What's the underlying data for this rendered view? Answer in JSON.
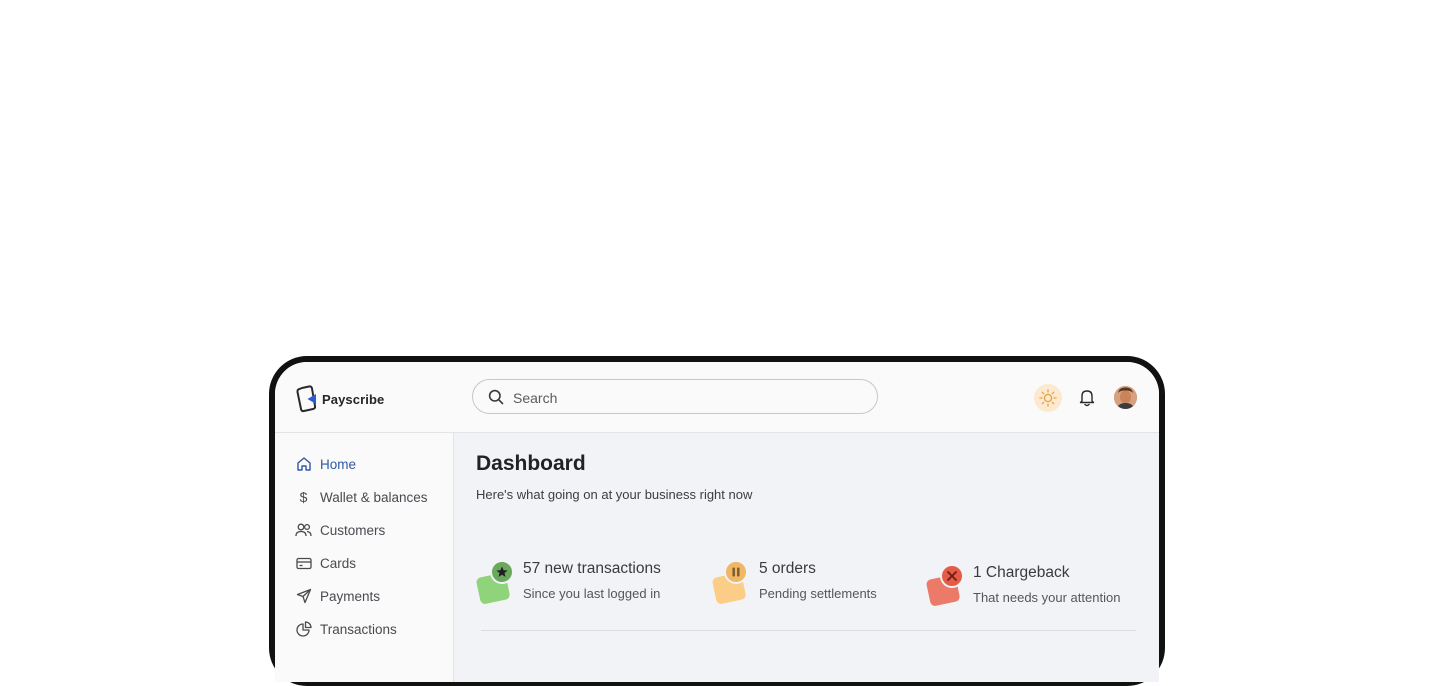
{
  "app": {
    "brand_name": "Payscribe"
  },
  "search": {
    "placeholder": "Search"
  },
  "colors": {
    "active_nav": "#2f58a6",
    "green_badge": "#8fd37b",
    "yellow_badge": "#fccd86",
    "red_badge": "#ec7a68",
    "theme_toggle_bg": "#fde9cf"
  },
  "header_icons": [
    "sun-icon",
    "bell-icon",
    "avatar"
  ],
  "sidebar": {
    "items": [
      {
        "label": "Home",
        "icon": "home-icon",
        "active": true
      },
      {
        "label": "Wallet & balances",
        "icon": "dollar-icon",
        "active": false
      },
      {
        "label": "Customers",
        "icon": "users-icon",
        "active": false
      },
      {
        "label": "Cards",
        "icon": "card-icon",
        "active": false
      },
      {
        "label": "Payments",
        "icon": "send-icon",
        "active": false
      },
      {
        "label": "Transactions",
        "icon": "pie-chart-icon",
        "active": false
      }
    ]
  },
  "main": {
    "title": "Dashboard",
    "subtitle": "Here's what going on at your business right now",
    "stats": [
      {
        "title": "57 new transactions",
        "subtitle": "Since you last logged in",
        "icon": "star-icon"
      },
      {
        "title": "5 orders",
        "subtitle": "Pending settlements",
        "icon": "pause-icon"
      },
      {
        "title": "1 Chargeback",
        "subtitle": "That needs your attention",
        "icon": "x-icon"
      }
    ]
  }
}
